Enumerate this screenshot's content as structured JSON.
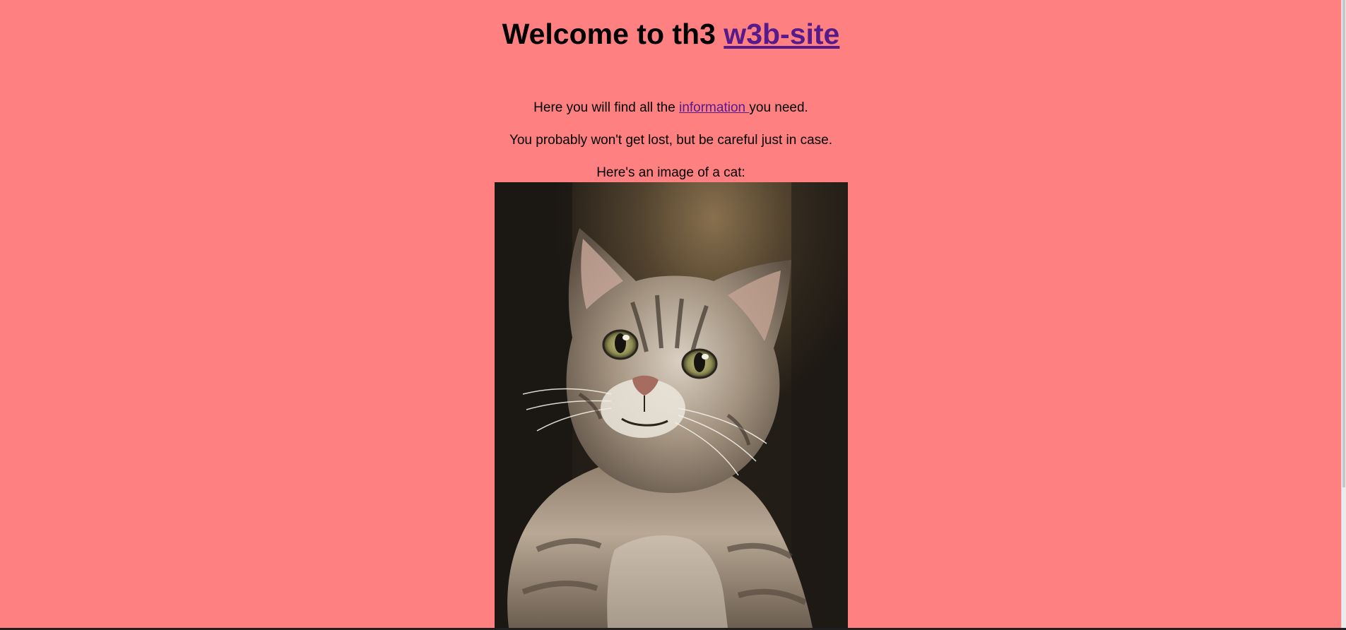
{
  "heading": {
    "prefix": "Welcome to th3 ",
    "link_text": "w3b-site"
  },
  "paragraphs": {
    "line1_before": "Here you will find all the ",
    "line1_link": "information ",
    "line1_after": "you need.",
    "line2": "You probably won't get lost, but be careful just in case.",
    "line3": "Here's an image of a cat:"
  },
  "colors": {
    "background": "#ff8080",
    "link": "#551a8b"
  },
  "image": {
    "subject": "cat"
  }
}
